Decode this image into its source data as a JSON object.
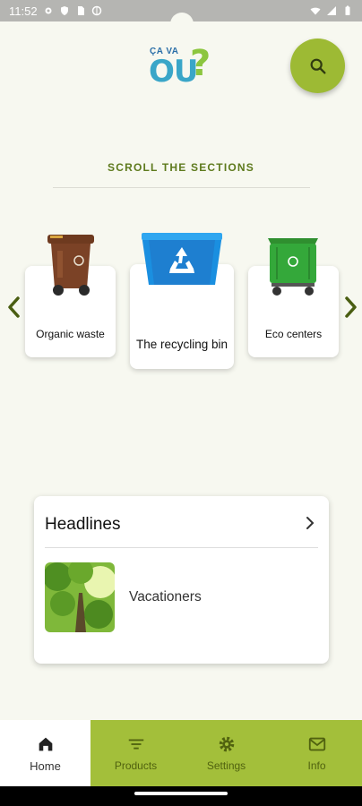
{
  "status_bar": {
    "time": "11:52",
    "icons": [
      "gear-icon",
      "shield-icon",
      "sim-card-icon",
      "vpn-icon",
      "wifi-icon",
      "signal-icon",
      "battery-icon"
    ]
  },
  "header": {
    "logo_small": "ÇA VA",
    "logo_big": "OU",
    "logo_mark": "?",
    "search_icon": "search-icon",
    "accent_color": "#9dba34"
  },
  "sections": {
    "title": "SCROLL THE SECTIONS",
    "items": [
      {
        "label": "Organic waste",
        "icon": "brown-bin-icon"
      },
      {
        "label": "The recycling bin",
        "icon": "blue-recycling-bin-icon"
      },
      {
        "label": "Eco centers",
        "icon": "green-container-icon"
      }
    ],
    "prev_icon": "chevron-left-icon",
    "next_icon": "chevron-right-icon"
  },
  "headlines": {
    "title": "Headlines",
    "items": [
      {
        "title": "Vacationers",
        "thumbnail": "forest-canopy-image"
      }
    ]
  },
  "bottom_nav": {
    "items": [
      {
        "label": "Home",
        "icon": "home-icon",
        "active": true
      },
      {
        "label": "Products",
        "icon": "filter-icon",
        "active": false
      },
      {
        "label": "Settings",
        "icon": "gear-icon",
        "active": false
      },
      {
        "label": "Info",
        "icon": "mail-icon",
        "active": false
      }
    ],
    "bar_color": "#a3bf3a"
  }
}
